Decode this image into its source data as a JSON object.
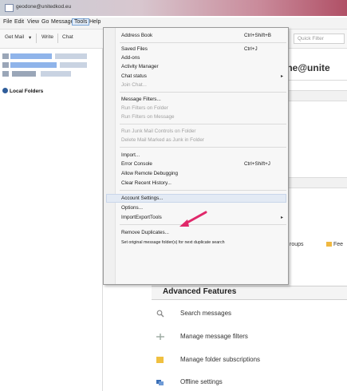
{
  "window": {
    "title": "geodone@unitedkod.eu"
  },
  "menubar": {
    "items": [
      "File",
      "Edit",
      "View",
      "Go",
      "Message",
      "Tools",
      "Help"
    ]
  },
  "toolbar": {
    "get_mail": "Get Mail",
    "dropdown": "▾",
    "write": "Write",
    "chat": "Chat",
    "quick_filter": "Quick Filter"
  },
  "account_header": {
    "title": "one@unite"
  },
  "folders": {
    "local_folders": "Local Folders"
  },
  "content": {
    "partial_groups": "roups",
    "partial_feeds": "Fee"
  },
  "tools_menu": {
    "items": [
      {
        "label": "Address Book",
        "shortcut": "Ctrl+Shift+B"
      },
      {
        "label": "Saved Files",
        "shortcut": "Ctrl+J"
      },
      {
        "label": "Add-ons",
        "shortcut": ""
      },
      {
        "label": "Activity Manager",
        "shortcut": ""
      },
      {
        "label": "Chat status",
        "shortcut": "",
        "submenu": "▸"
      },
      {
        "label": "Join Chat...",
        "shortcut": "",
        "disabled": true
      },
      {
        "label": "Message Filters...",
        "shortcut": ""
      },
      {
        "label": "Run Filters on Folder",
        "shortcut": "",
        "disabled": true
      },
      {
        "label": "Run Filters on Message",
        "shortcut": "",
        "disabled": true
      },
      {
        "label": "Run Junk Mail Controls on Folder",
        "shortcut": "",
        "disabled": true
      },
      {
        "label": "Delete Mail Marked as Junk in Folder",
        "shortcut": "",
        "disabled": true
      },
      {
        "label": "Import...",
        "shortcut": ""
      },
      {
        "label": "Error Console",
        "shortcut": "Ctrl+Shift+J"
      },
      {
        "label": "Allow Remote Debugging",
        "shortcut": ""
      },
      {
        "label": "Clear Recent History...",
        "shortcut": ""
      },
      {
        "label": "Account Settings...",
        "shortcut": "",
        "highlighted": true
      },
      {
        "label": "Options...",
        "shortcut": ""
      },
      {
        "label": "ImportExportTools",
        "shortcut": "",
        "submenu": "▸"
      },
      {
        "label": "Remove Duplicates...",
        "shortcut": ""
      },
      {
        "label": "Set original message folder(s) for next duplicate search",
        "shortcut": ""
      }
    ]
  },
  "advanced": {
    "title": "Advanced Features",
    "items": [
      {
        "label": "Search messages",
        "icon": "search-icon"
      },
      {
        "label": "Manage message filters",
        "icon": "filter-icon"
      },
      {
        "label": "Manage folder subscriptions",
        "icon": "folder-icon"
      },
      {
        "label": "Offline settings",
        "icon": "offline-icon"
      }
    ]
  },
  "colors": {
    "arrow": "#e0286a",
    "highlight": "#e3eaf4",
    "folder": "#f0c040"
  }
}
